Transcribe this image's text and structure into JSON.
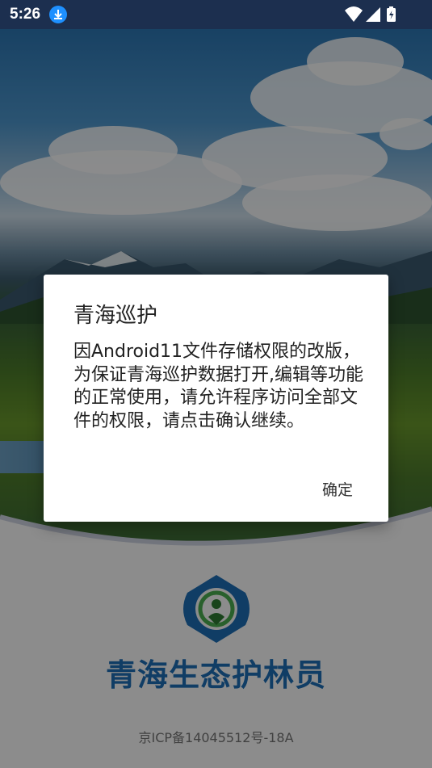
{
  "status_bar": {
    "time": "5:26",
    "icons": [
      "download-icon",
      "wifi-icon",
      "signal-icon",
      "battery-charging-icon"
    ],
    "background": "#1c2f4f"
  },
  "app": {
    "name": "青海生态护林员",
    "icp": "京ICP备14045512号-18A",
    "brand_color": "#1e6fb8"
  },
  "dialog": {
    "title": "青海巡护",
    "message": "因Android11文件存储权限的改版，为保证青海巡护数据打开,编辑等功能的正常使用，请允许程序访问全部文件的权限，请点击确认继续。",
    "confirm_label": "确定"
  }
}
